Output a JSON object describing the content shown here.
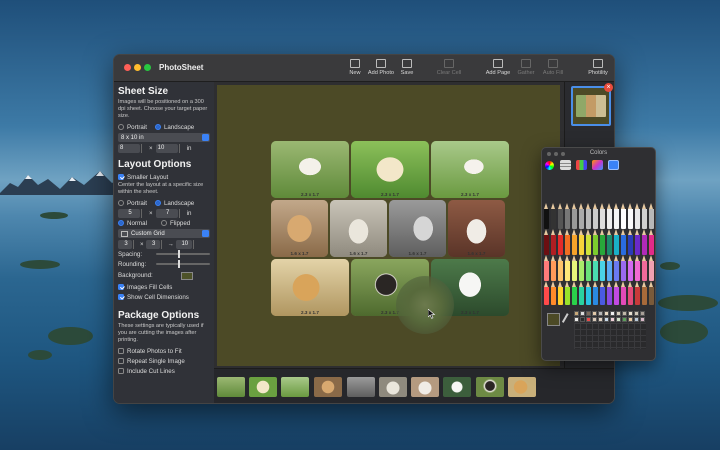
{
  "app": {
    "title": "PhotoSheet"
  },
  "toolbar": {
    "items": [
      {
        "label": "New",
        "icon": "doc-icon",
        "enabled": true
      },
      {
        "label": "Add Photo",
        "icon": "photo-icon",
        "enabled": true
      },
      {
        "label": "Save",
        "icon": "save-icon",
        "enabled": true
      },
      {
        "label": "Clear Cell",
        "icon": "trash-icon",
        "enabled": false
      },
      {
        "label": "Add Page",
        "icon": "add-page-icon",
        "enabled": true
      },
      {
        "label": "Gather",
        "icon": "gather-icon",
        "enabled": false
      },
      {
        "label": "Auto Fill",
        "icon": "auto-fill-icon",
        "enabled": false
      },
      {
        "label": "Photility",
        "icon": "briefcase-icon",
        "enabled": true
      }
    ]
  },
  "sheet_size": {
    "title": "Sheet Size",
    "description": "Images will be positioned on a 300 dpi sheet. Choose your target paper size.",
    "portrait_label": "Portrait",
    "landscape_label": "Landscape",
    "orientation": "Landscape",
    "paper_size": "8 x 10 in",
    "width": "8",
    "times": "×",
    "height": "10",
    "unit": "in"
  },
  "layout_options": {
    "title": "Layout Options",
    "smaller_layout_label": "Smaller Layout",
    "description": "Center the layout at a specific size within the sheet.",
    "portrait_label": "Portrait",
    "landscape_label": "Landscape",
    "width": "5",
    "times": "×",
    "height": "7",
    "unit": "in",
    "normal_label": "Normal",
    "flipped_label": "Flipped",
    "grid": "Custom Grid",
    "cols": "3",
    "rows": "3",
    "arrow": "→",
    "count": "10",
    "spacing_label": "Spacing:",
    "rounding_label": "Rounding:",
    "background_label": "Background:",
    "background_color": "#4c4a26",
    "images_fill_label": "Images Fill Cells",
    "show_dims_label": "Show Cell Dimensions"
  },
  "package_options": {
    "title": "Package Options",
    "description": "These settings are typically used if you are cutting the images after printing.",
    "rotate_label": "Rotate Photos to Fit",
    "repeat_label": "Repeat Single Image",
    "cut_lines_label": "Include Cut Lines"
  },
  "cells": [
    {
      "dim": "2.3 x 1.7"
    },
    {
      "dim": "2.3 x 1.7"
    },
    {
      "dim": "2.3 x 1.7"
    },
    {
      "dim": "1.6 x 1.7"
    },
    {
      "dim": "1.6 x 1.7"
    },
    {
      "dim": "1.6 x 1.7"
    },
    {
      "dim": "1.6 x 1.7"
    },
    {
      "dim": "2.3 x 1.7"
    },
    {
      "dim": "2.3 x 1.7"
    },
    {
      "dim": "2.3 x 1.7"
    }
  ],
  "colors_panel": {
    "title": "Colors"
  }
}
